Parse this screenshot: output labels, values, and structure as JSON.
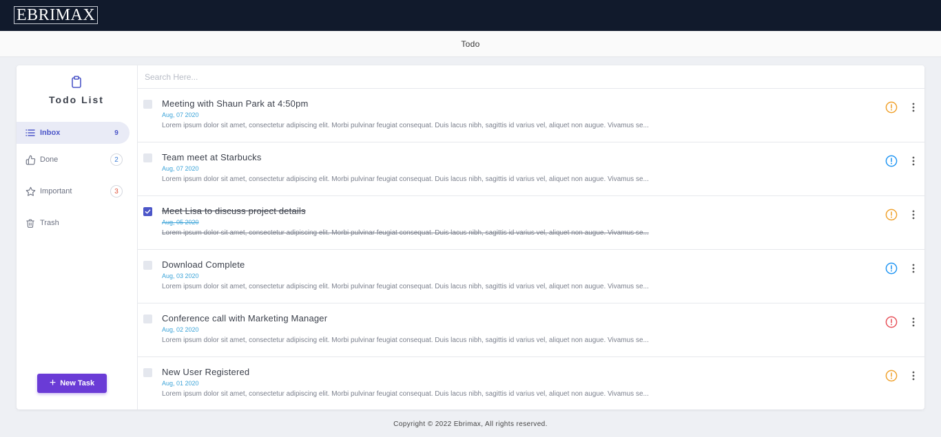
{
  "header": {
    "logo_text": "EBRIMAX"
  },
  "subbar": {
    "title": "Todo"
  },
  "sidebar": {
    "title": "Todo List",
    "items": [
      {
        "label": "Inbox",
        "count": "9",
        "icon": "list-icon"
      },
      {
        "label": "Done",
        "count": "2",
        "icon": "thumbs-up-icon"
      },
      {
        "label": "Important",
        "count": "3",
        "icon": "star-icon"
      },
      {
        "label": "Trash",
        "icon": "trash-icon"
      }
    ],
    "new_task_label": "New Task"
  },
  "search": {
    "placeholder": "Search Here..."
  },
  "tasks": [
    {
      "title": "Meeting with Shaun Park at 4:50pm",
      "date": "Aug, 07 2020",
      "description": "Lorem ipsum dolor sit amet, consectetur adipiscing elit. Morbi pulvinar feugiat consequat. Duis lacus nibh, sagittis id varius vel, aliquet non augue. Vivamus se...",
      "done": false,
      "priority_color": "#f0a22e"
    },
    {
      "title": "Team meet at Starbucks",
      "date": "Aug, 07 2020",
      "description": "Lorem ipsum dolor sit amet, consectetur adipiscing elit. Morbi pulvinar feugiat consequat. Duis lacus nibh, sagittis id varius vel, aliquet non augue. Vivamus se...",
      "done": false,
      "priority_color": "#2196f3"
    },
    {
      "title": "Meet Lisa to discuss project details",
      "date": "Aug, 05 2020",
      "description": "Lorem ipsum dolor sit amet, consectetur adipiscing elit. Morbi pulvinar feugiat consequat. Duis lacus nibh, sagittis id varius vel, aliquet non augue. Vivamus se...",
      "done": true,
      "priority_color": "#f0a22e"
    },
    {
      "title": "Download Complete",
      "date": "Aug, 03 2020",
      "description": "Lorem ipsum dolor sit amet, consectetur adipiscing elit. Morbi pulvinar feugiat consequat. Duis lacus nibh, sagittis id varius vel, aliquet non augue. Vivamus se...",
      "done": false,
      "priority_color": "#2196f3"
    },
    {
      "title": "Conference call with Marketing Manager",
      "date": "Aug, 02 2020",
      "description": "Lorem ipsum dolor sit amet, consectetur adipiscing elit. Morbi pulvinar feugiat consequat. Duis lacus nibh, sagittis id varius vel, aliquet non augue. Vivamus se...",
      "done": false,
      "priority_color": "#e7515a"
    },
    {
      "title": "New User Registered",
      "date": "Aug, 01 2020",
      "description": "Lorem ipsum dolor sit amet, consectetur adipiscing elit. Morbi pulvinar feugiat consequat. Duis lacus nibh, sagittis id varius vel, aliquet non augue. Vivamus se...",
      "done": false,
      "priority_color": "#f0a22e"
    }
  ],
  "footer": {
    "copyright": "Copyright © 2022 Ebrimax, All rights reserved."
  }
}
